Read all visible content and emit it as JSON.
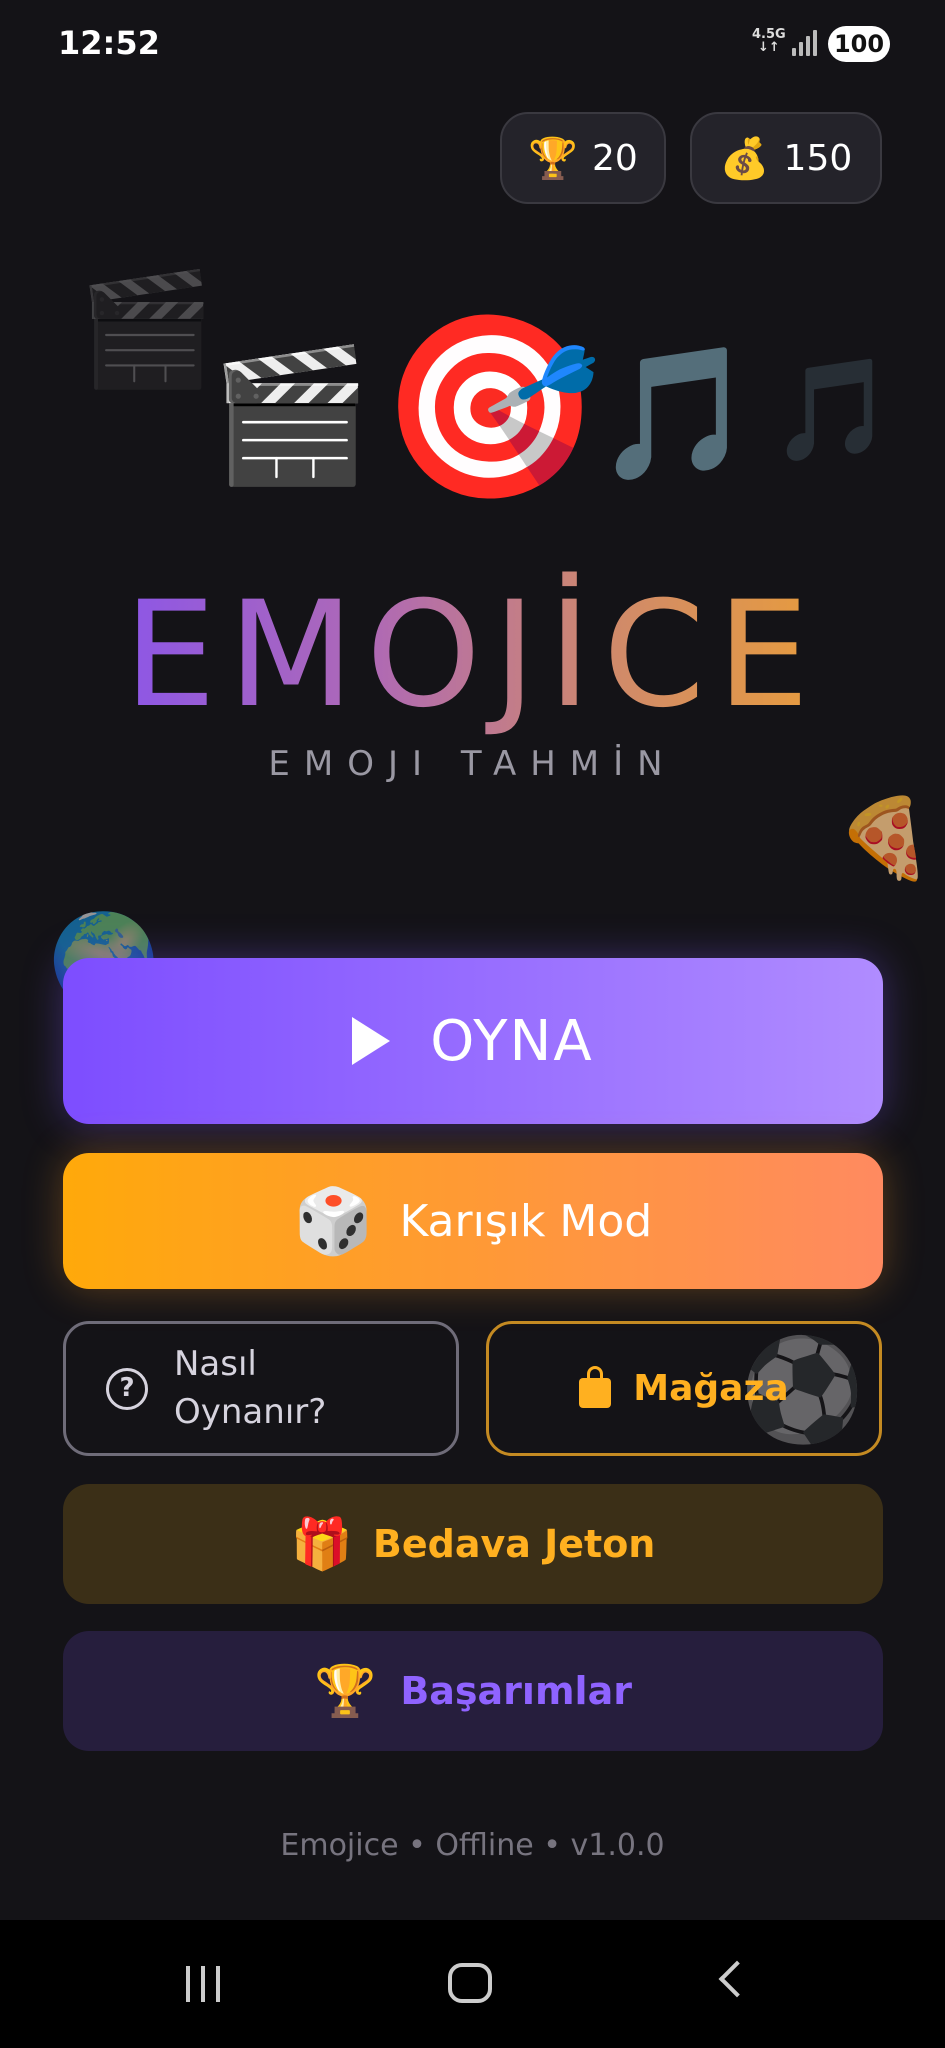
{
  "status_bar": {
    "time": "12:52",
    "network": "4.5G",
    "battery": "100"
  },
  "stats": {
    "trophies": {
      "icon": "🏆",
      "value": "20"
    },
    "coins": {
      "icon": "💰",
      "value": "150"
    }
  },
  "hero_emojis": [
    "🎬",
    "🎯",
    "🎵"
  ],
  "logo": {
    "title": "EMOJİCE",
    "subtitle": "EMOJI TAHMİN"
  },
  "buttons": {
    "play": "OYNA",
    "mixed": {
      "icon": "🎲",
      "label": "Karışık Mod"
    },
    "howto": {
      "line1": "Nasıl",
      "line2": "Oynanır?"
    },
    "shop": "Mağaza",
    "free": {
      "icon": "🎁",
      "label": "Bedava Jeton"
    },
    "achievements": {
      "icon": "🏆",
      "label": "Başarımlar"
    }
  },
  "footer": "Emojice • Offline • v1.0.0",
  "colors": {
    "play_start": "#7d4dff",
    "play_end": "#b08cff",
    "mixed_start": "#ffa90a",
    "mixed_end": "#ff8a60",
    "gold": "#ffb020",
    "purple": "#8f63ff"
  }
}
